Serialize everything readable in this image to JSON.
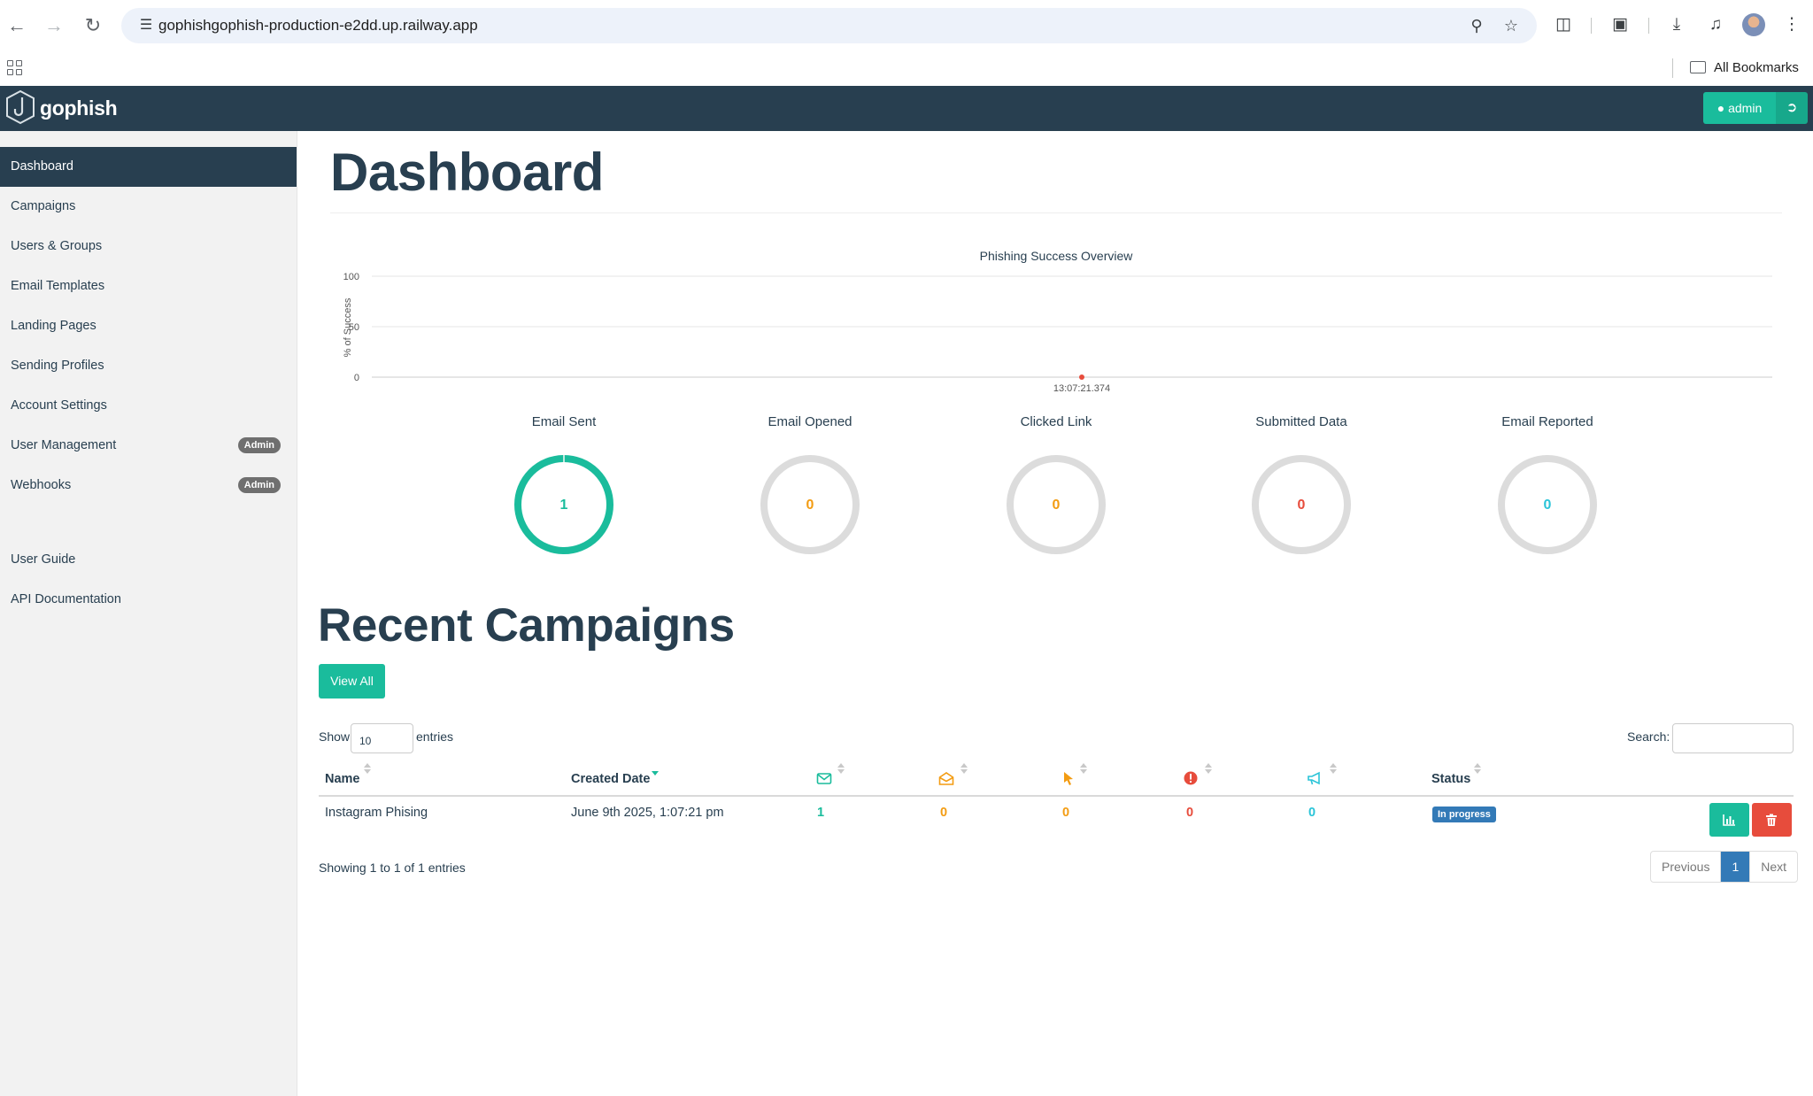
{
  "browser": {
    "url": "gophishgophish-production-e2dd.up.railway.app",
    "bookmarks_label": "All Bookmarks"
  },
  "header": {
    "logo_text": "gophish",
    "user_label": "admin"
  },
  "sidebar": {
    "items": [
      {
        "label": "Dashboard",
        "active": true
      },
      {
        "label": "Campaigns"
      },
      {
        "label": "Users & Groups"
      },
      {
        "label": "Email Templates"
      },
      {
        "label": "Landing Pages"
      },
      {
        "label": "Sending Profiles"
      },
      {
        "label": "Account Settings"
      },
      {
        "label": "User Management",
        "badge": "Admin"
      },
      {
        "label": "Webhooks",
        "badge": "Admin"
      },
      {
        "label": "User Guide"
      },
      {
        "label": "API Documentation"
      }
    ]
  },
  "main": {
    "title": "Dashboard",
    "recent_title": "Recent Campaigns",
    "view_all_label": "View All"
  },
  "chart_data": {
    "type": "line",
    "title": "Phishing Success Overview",
    "ylabel": "% of Success",
    "xlabel": "",
    "ylim": [
      0,
      100
    ],
    "yticks": [
      0,
      50,
      100
    ],
    "grid": true,
    "x": [
      "13:07:21.374"
    ],
    "series": [
      {
        "values": [
          0
        ],
        "color": "#e74c3c"
      }
    ]
  },
  "stats": [
    {
      "label": "Email Sent",
      "value": "1",
      "fraction": 1,
      "color": "#1abc9c"
    },
    {
      "label": "Email Opened",
      "value": "0",
      "fraction": 0,
      "color": "#f39c12"
    },
    {
      "label": "Clicked Link",
      "value": "0",
      "fraction": 0,
      "color": "#f39c12"
    },
    {
      "label": "Submitted Data",
      "value": "0",
      "fraction": 0,
      "color": "#e74c3c"
    },
    {
      "label": "Email Reported",
      "value": "0",
      "fraction": 0,
      "color": "#2ac4d8"
    }
  ],
  "table": {
    "show_label": "Show",
    "page_size": "10",
    "entries_label": "entries",
    "search_label": "Search:",
    "headers": {
      "name": "Name",
      "created": "Created Date",
      "status": "Status"
    },
    "rows": [
      {
        "name": "Instagram Phising",
        "created": "June 9th 2025, 1:07:21 pm",
        "sent": "1",
        "opened": "0",
        "clicked": "0",
        "submitted": "0",
        "reported": "0",
        "status": "In progress"
      }
    ],
    "showing_text": "Showing 1 to 1 of 1 entries",
    "pagination": {
      "previous": "Previous",
      "current": "1",
      "next": "Next"
    }
  },
  "colors": {
    "navy": "#283f50",
    "accent": "#1abc9c",
    "danger": "#e74c3c",
    "warning": "#f39c12",
    "info": "#2ac4d8",
    "primary": "#337ab7"
  }
}
